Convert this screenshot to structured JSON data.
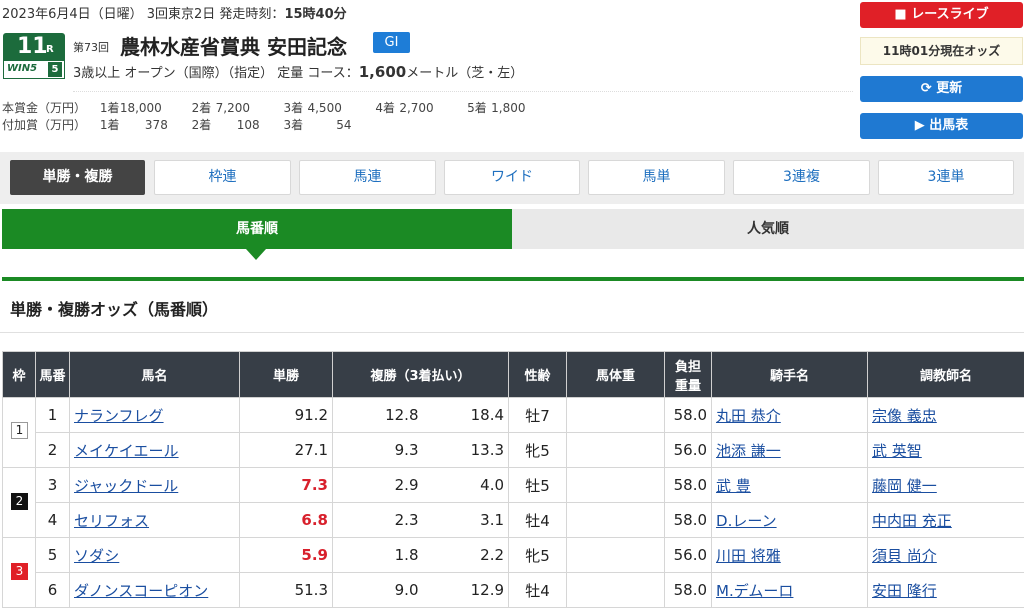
{
  "header": {
    "date_prefix": "2023年6月4日（日曜） 3回東京2日 発走時刻：",
    "post_time": "15時40分",
    "race_number": "11",
    "race_number_suffix": "R",
    "win5_logo": "WIN5",
    "win5_leg": "5",
    "kaiji": "第73回",
    "race_name": "農林水産省賞典 安田記念",
    "grade": "GI",
    "cond_prefix": "3歳以上 オープン（国際）（指定） 定量 コース：",
    "distance": "1,600",
    "cond_suffix": "メートル（芝・左）"
  },
  "prize": {
    "main_label": "本賞金（万円）",
    "main": [
      [
        "1着",
        "18,000"
      ],
      [
        "2着",
        "7,200"
      ],
      [
        "3着",
        "4,500"
      ],
      [
        "4着",
        "2,700"
      ],
      [
        "5着",
        "1,800"
      ]
    ],
    "add_label": "付加賞（万円）",
    "add": [
      [
        "1着",
        "378"
      ],
      [
        "2着",
        "108"
      ],
      [
        "3着",
        "54"
      ]
    ]
  },
  "side": {
    "live_label": "レースライブ",
    "odds_time": "11時01分現在オッズ",
    "refresh_label": "更新",
    "card_label": "出馬表"
  },
  "tabs": [
    "単勝・複勝",
    "枠連",
    "馬連",
    "ワイド",
    "馬単",
    "3連複",
    "3連単"
  ],
  "sort": {
    "by_number": "馬番順",
    "by_popularity": "人気順"
  },
  "section_title": "単勝・複勝オッズ（馬番順）",
  "table": {
    "headers": {
      "waku": "枠",
      "umaban": "馬番",
      "name": "馬名",
      "win": "単勝",
      "place": "複勝（3着払い）",
      "sexage": "性齢",
      "weight": "馬体重",
      "burden1": "負担",
      "burden2": "重量",
      "jockey": "騎手名",
      "trainer": "調教師名"
    },
    "rows": [
      {
        "waku": "1",
        "umaban": "1",
        "name": "ナランフレグ",
        "win": "91.2",
        "place_lo": "12.8",
        "place_hi": "18.4",
        "sexage": "牡7",
        "burden": "58.0",
        "jockey": "丸田 恭介",
        "trainer": "宗像 義忠"
      },
      {
        "waku": "",
        "umaban": "2",
        "name": "メイケイエール",
        "win": "27.1",
        "place_lo": "9.3",
        "place_hi": "13.3",
        "sexage": "牝5",
        "burden": "56.0",
        "jockey": "池添 謙一",
        "trainer": "武 英智"
      },
      {
        "waku": "2",
        "umaban": "3",
        "name": "ジャックドール",
        "win": "7.3",
        "place_lo": "2.9",
        "place_hi": "4.0",
        "sexage": "牡5",
        "burden": "58.0",
        "jockey": "武 豊",
        "trainer": "藤岡 健一"
      },
      {
        "waku": "",
        "umaban": "4",
        "name": "セリフォス",
        "win": "6.8",
        "place_lo": "2.3",
        "place_hi": "3.1",
        "sexage": "牡4",
        "burden": "58.0",
        "jockey": "D.レーン",
        "trainer": "中内田 充正"
      },
      {
        "waku": "3",
        "umaban": "5",
        "name": "ソダシ",
        "win": "5.9",
        "place_lo": "1.8",
        "place_hi": "2.2",
        "sexage": "牝5",
        "burden": "56.0",
        "jockey": "川田 将雅",
        "trainer": "須貝 尚介"
      },
      {
        "waku": "",
        "umaban": "6",
        "name": "ダノンスコーピオン",
        "win": "51.3",
        "place_lo": "9.0",
        "place_hi": "12.9",
        "sexage": "牡4",
        "burden": "58.0",
        "jockey": "M.デムーロ",
        "trainer": "安田 隆行"
      }
    ],
    "place_separator": "-"
  },
  "colors": {
    "race_green": "#1c6b3c",
    "tab_green": "#1b8a24",
    "live_red": "#e02027",
    "button_blue": "#1f79d2",
    "grade_blue": "#1e7dd7",
    "hot_odds": "#d8202c",
    "waku2": "#000000",
    "waku3": "#e02027"
  }
}
